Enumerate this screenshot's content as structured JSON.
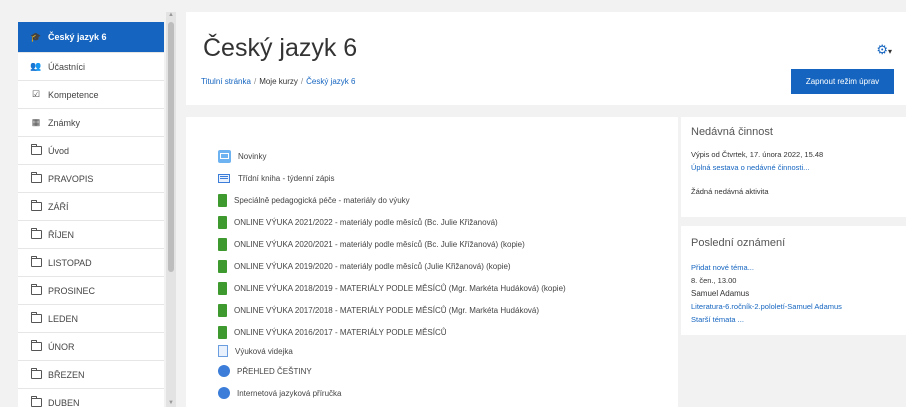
{
  "sidebar": {
    "items": [
      {
        "label": "Český jazyk 6",
        "icon": "graduation-cap-icon"
      },
      {
        "label": "Účastníci",
        "icon": "users-icon"
      },
      {
        "label": "Kompetence",
        "icon": "checkbox-icon"
      },
      {
        "label": "Známky",
        "icon": "table-icon"
      },
      {
        "label": "Úvod",
        "icon": "folder-icon"
      },
      {
        "label": "PRAVOPIS",
        "icon": "folder-icon"
      },
      {
        "label": "ZÁŘÍ",
        "icon": "folder-icon"
      },
      {
        "label": "ŘÍJEN",
        "icon": "folder-icon"
      },
      {
        "label": "LISTOPAD",
        "icon": "folder-icon"
      },
      {
        "label": "PROSINEC",
        "icon": "folder-icon"
      },
      {
        "label": "LEDEN",
        "icon": "folder-icon"
      },
      {
        "label": "ÚNOR",
        "icon": "folder-icon"
      },
      {
        "label": "BŘEZEN",
        "icon": "folder-icon"
      },
      {
        "label": "DUBEN",
        "icon": "folder-icon"
      }
    ]
  },
  "header": {
    "title": "Český jazyk 6",
    "breadcrumb": [
      "Titulní stránka",
      "Moje kurzy",
      "Český jazyk 6"
    ],
    "edit_button": "Zapnout režim úprav"
  },
  "activities": [
    {
      "label": "Novinky",
      "icon": "news-icon"
    },
    {
      "label": "Třídní kniha - týdenní zápis",
      "icon": "book-icon"
    },
    {
      "label": "Speciálně pedagogická péče - materiály do výuky",
      "icon": "folder-green-icon"
    },
    {
      "label": "ONLINE VÝUKA 2021/2022 - materiály podle měsíců (Bc. Julie Křižanová)",
      "icon": "folder-green-icon"
    },
    {
      "label": "ONLINE VÝUKA 2020/2021 - materiály podle měsíců (Bc. Julie Křížanová) (kopie)",
      "icon": "folder-green-icon"
    },
    {
      "label": "ONLINE VÝUKA 2019/2020 - materiály podle měsíců (Julie Křižanová) (kopie)",
      "icon": "folder-green-icon"
    },
    {
      "label": "ONLINE VÝUKA 2018/2019 - MATERIÁLY PODLE MĚSÍCŮ (Mgr. Markéta Hudáková) (kopie)",
      "icon": "folder-green-icon"
    },
    {
      "label": "ONLINE VÝUKA 2017/2018 - MATERIÁLY PODLE MĚSÍCŮ (Mgr. Markéta Hudáková)",
      "icon": "folder-green-icon"
    },
    {
      "label": "ONLINE VÝUKA 2016/2017 - MATERIÁLY PODLE MĚSÍCŮ",
      "icon": "folder-green-icon"
    },
    {
      "label": "Výuková videjka",
      "icon": "page-icon"
    },
    {
      "label": "PŘEHLED ČEŠTINY",
      "icon": "resource-icon"
    },
    {
      "label": "Internetová jazyková příručka",
      "icon": "resource-icon"
    }
  ],
  "recent": {
    "title": "Nedávná činnost",
    "since": "Výpis od Čtvrtek, 17. února 2022, 15.48",
    "full_report": "Úplná sestava o nedávné činnosti...",
    "none": "Žádná nedávná aktivita"
  },
  "announcements": {
    "title": "Poslední oznámení",
    "add_new": "Přidat nové téma...",
    "date": "8. čen., 13.00",
    "author": "Samuel Adamus",
    "post": "Literatura-6.ročník-2.pololetí-Samuel Adamus",
    "older": "Starší témata ..."
  },
  "colors": {
    "accent": "#1565c0",
    "folder_green": "#3e9a2f"
  }
}
